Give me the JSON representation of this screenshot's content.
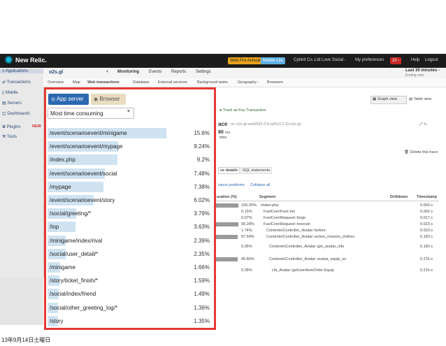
{
  "topbar": {
    "logo": "New Relic.",
    "badges": [
      "Web Pro Annual",
      "Mobile Lite"
    ],
    "account": "Cybird Co.,Ltd Love Social -",
    "preferences": "My preferences",
    "count": "10 -",
    "help": "Help",
    "logout": "Logout"
  },
  "sidebar": {
    "items": [
      "Applications",
      "Transactions",
      "Mobile",
      "Servers",
      "Dashboards",
      "Plugins",
      "Tools"
    ],
    "new_badge": "NEW"
  },
  "app": {
    "name": "o2s.gl",
    "tabs": [
      "Monitoring",
      "Events",
      "Reports",
      "Settings"
    ],
    "time_range": "Last 30 minutes -",
    "ending": "Ending now",
    "subtabs": [
      "Overview",
      "Map",
      "Web transactions",
      "Database",
      "External services",
      "Background tasks",
      "Geography -",
      "Browsers"
    ]
  },
  "right": {
    "graph_view": "Graph view",
    "table_view": "Table view",
    "track_key": "Track as Key Transaction",
    "trace_title": "ace",
    "trace_sub": "on o2s-gl-web05(5.3.5+a2h(2.2.3):o2s.gl)",
    "ms": "80",
    "ms_unit": "ms",
    "time_label": "time",
    "delete_trace": "Delete this trace",
    "detail_tabs": [
      "ce details",
      "SQL statements"
    ],
    "links": [
      "rance problems",
      "Collapse all"
    ],
    "table_headers": [
      "uration (%)",
      "Segment",
      "Drilldown",
      "Timestamp"
    ],
    "rows": [
      {
        "pct": "100.00%",
        "seg": "/index.php",
        "ts": "0.000 s",
        "bar": 100
      },
      {
        "pct": "0.15%",
        "seg": "FuelCore\\Fuel::init",
        "ts": "0.002 s",
        "bar": 0.15
      },
      {
        "pct": "0.07%",
        "seg": "FuelCore\\Request::forge",
        "ts": "0.017 s",
        "bar": 0.07
      },
      {
        "pct": "99.28%",
        "seg": "FuelCore\\Request::execute",
        "ts": "0.023 s",
        "bar": 99.28
      },
      {
        "pct": "1.74%",
        "seg": "Contents\\Controller_Avatar::before",
        "ts": "0.023 s",
        "bar": 1.74
      },
      {
        "pct": "97.54%",
        "seg": "Contents\\Controller_Avatar::action_mission_clothes",
        "ts": "0.183 s",
        "bar": 97.54
      },
      {
        "pct": "0.35%",
        "seg": "Contents\\Controller_Avatar::get_avatar_info",
        "ts": "0.183 s",
        "bar": 0.35
      },
      {
        "pct": "96.86%",
        "seg": "Contents\\Controller_Avatar::avatar_equip_on",
        "ts": "0.215 s",
        "bar": 96.86
      },
      {
        "pct": "0.28%",
        "seg": "Lib_Avatar::getUserItemOrder Equip",
        "ts": "0.215 s",
        "bar": 0.28
      }
    ]
  },
  "panel": {
    "tab_app": "App server",
    "tab_browser": "Browser",
    "sort_value": "Most time consuming",
    "transactions": [
      {
        "name": "/event/scenarioevent/minigame",
        "value": "15.6%",
        "pct": 15.6
      },
      {
        "name": "/event/scenarioevent/mypage",
        "value": "9.24%",
        "pct": 9.24
      },
      {
        "name": "/index.php",
        "value": "9.2%",
        "pct": 9.2
      },
      {
        "name": "/event/scenarioevent/social",
        "value": "7.48%",
        "pct": 7.48
      },
      {
        "name": "/mypage",
        "value": "7.38%",
        "pct": 7.38
      },
      {
        "name": "/event/scenarioevent/story",
        "value": "6.02%",
        "pct": 6.02
      },
      {
        "name": "/social/greeting/*",
        "value": "3.79%",
        "pct": 3.79
      },
      {
        "name": "/top",
        "value": "3.63%",
        "pct": 3.63
      },
      {
        "name": "/minigame/index/rival",
        "value": "2.39%",
        "pct": 2.39
      },
      {
        "name": "/social/user_detail/*",
        "value": "2.35%",
        "pct": 2.35
      },
      {
        "name": "/minigame",
        "value": "1.66%",
        "pct": 1.66
      },
      {
        "name": "/story/ticket_finish/*",
        "value": "1.59%",
        "pct": 1.59
      },
      {
        "name": "/social/index/friend",
        "value": "1.49%",
        "pct": 1.49
      },
      {
        "name": "/social/other_greeting_log/*",
        "value": "1.36%",
        "pct": 1.36
      },
      {
        "name": "/story",
        "value": "1.35%",
        "pct": 1.35
      }
    ]
  },
  "footer_date": "13年9月14日土曜日"
}
